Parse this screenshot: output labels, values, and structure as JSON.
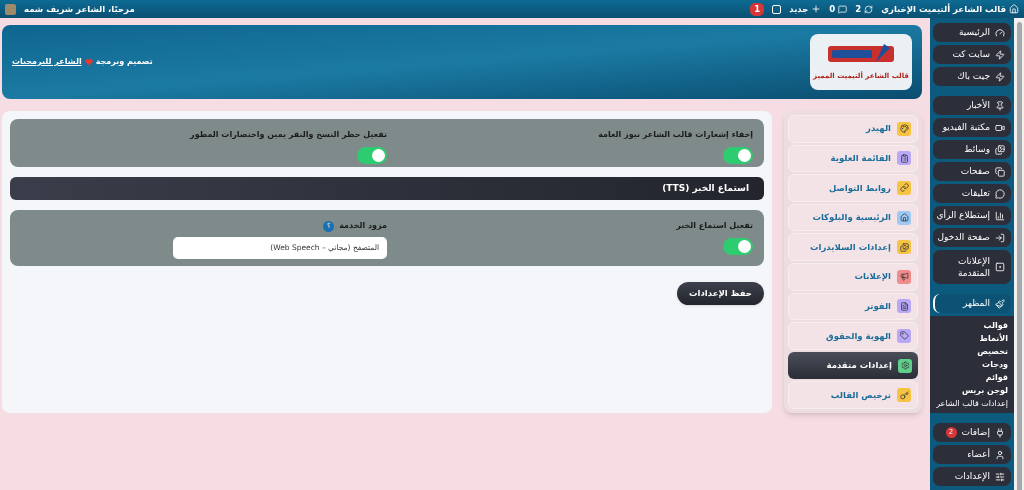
{
  "admin_bar": {
    "site_title": "قالب الشاعر ألتيميت الإخباري",
    "updates": "2",
    "comments": "0",
    "new": "جديد",
    "notifications": "1",
    "greeting": "مرحبًا، الشاعر شريف شمه"
  },
  "header": {
    "logo_caption": "قالب الشاعر ألتيميت المميز",
    "credit_prefix": "تصميم وبرمجة",
    "credit_link": "الشاعر للبرمجيات"
  },
  "tabs": [
    {
      "label": "الهيدر",
      "selected": false
    },
    {
      "label": "القائمة العلوية",
      "selected": false
    },
    {
      "label": "روابط التواصل",
      "selected": false
    },
    {
      "label": "الرئيسية والبلوكات",
      "selected": false
    },
    {
      "label": "إعدادات السلايدرات",
      "selected": false
    },
    {
      "label": "الإعلانات",
      "selected": false
    },
    {
      "label": "الفوتر",
      "selected": false
    },
    {
      "label": "الهوية والحقوق",
      "selected": false
    },
    {
      "label": "إعدادات متقدمة",
      "selected": true
    },
    {
      "label": "ترخيص القالب",
      "selected": false
    }
  ],
  "settings": {
    "toggles": [
      {
        "label": "إخفاء إشعارات قالب الشاعر نيوز العامة",
        "on": true
      },
      {
        "label": "تفعيل حظر النسخ والنقر يمين واختصارات المطور",
        "on": true
      }
    ],
    "tts": {
      "title": "استماع الخبر (TTS)",
      "toggle": {
        "label": "تفعيل استماع الخبر",
        "on": true
      },
      "provider": {
        "label": "مزود الخدمة",
        "help": "؟",
        "value": "المتصفح (مجاني – Web Speech)"
      }
    },
    "save": "حفظ الإعدادات"
  },
  "sidebar": [
    {
      "items": [
        {
          "label": "الرئيسية"
        },
        {
          "label": "سايت كت"
        },
        {
          "label": "جيت باك"
        }
      ]
    },
    {
      "items": [
        {
          "label": "الأخبار"
        },
        {
          "label": "مكتبة الفيديو"
        },
        {
          "label": "وسائط"
        },
        {
          "label": "صفحات"
        },
        {
          "label": "تعليقات"
        },
        {
          "label": "إستطلاع الرأي"
        },
        {
          "label": "صفحة الدخول"
        },
        {
          "label": "الإعلانات المتقدمة"
        }
      ]
    },
    {
      "items": [
        {
          "label": "المظهر",
          "current": true,
          "children": [
            {
              "label": "قوالب",
              "selected": false
            },
            {
              "label": "الأنماط",
              "selected": false
            },
            {
              "label": "تخصيص",
              "selected": false
            },
            {
              "label": "ودجات",
              "selected": false
            },
            {
              "label": "قوائم",
              "selected": false
            },
            {
              "label": "لوجن بريس",
              "selected": false
            },
            {
              "label": "إعدادات قالب الشاعر",
              "selected": true
            }
          ]
        }
      ]
    },
    {
      "items": [
        {
          "label": "إضافات",
          "badge": "2"
        },
        {
          "label": "أعضاء"
        },
        {
          "label": "الإعدادات"
        }
      ]
    }
  ]
}
